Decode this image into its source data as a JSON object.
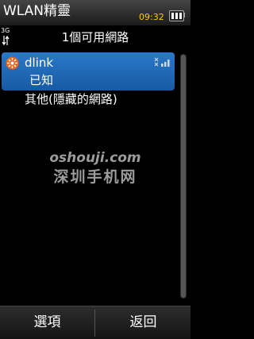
{
  "status_bar": {
    "app_title": "WLAN精靈",
    "clock": "09:32",
    "network_type": "3G"
  },
  "heading": "1個可用網路",
  "networks": [
    {
      "name": "dlink",
      "status": "已知",
      "icon": "wlan-network-icon",
      "signal_icon": "signal-strength-icon",
      "selected": true
    }
  ],
  "other_networks_label": "其他(隱藏的網路)",
  "watermark": {
    "domain": "oshouji.com",
    "name": "深圳手机网"
  },
  "softkeys": {
    "left": "選項",
    "right": "返回"
  },
  "colors": {
    "selection": "#1f69b8",
    "clock": "#ffcc00",
    "background": "#000000"
  }
}
